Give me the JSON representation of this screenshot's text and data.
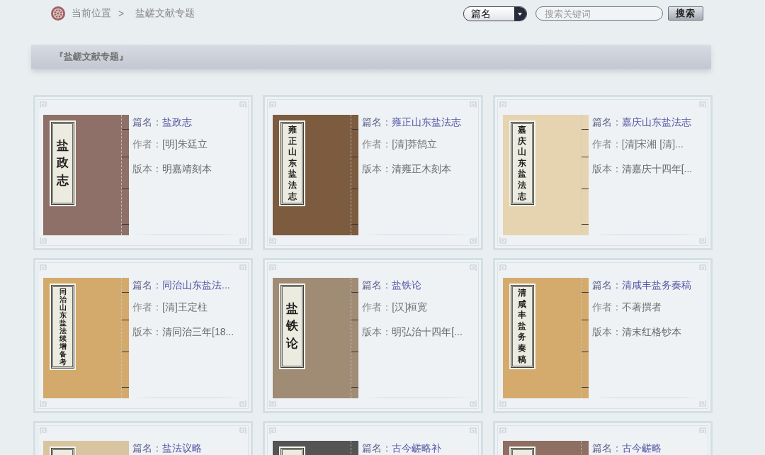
{
  "breadcrumb": {
    "label": "当前位置",
    "separator": ">",
    "current": "盐鹾文献专题"
  },
  "search": {
    "field": "篇名",
    "placeholder": "搜索关键词",
    "button": "搜索"
  },
  "section": {
    "title": "『盐鹾文献专题』"
  },
  "books": [
    {
      "title_label": "篇名：",
      "title": "盐政志",
      "author_label": "作者：",
      "author": "[明]朱廷立",
      "edition_label": "版本：",
      "edition": "明嘉靖刻本",
      "cover_text": "盐政志",
      "color": "#8f7068"
    },
    {
      "title_label": "篇名：",
      "title": "雍正山东盐法志",
      "author_label": "作者：",
      "author": "[清]莽鹄立",
      "edition_label": "版本：",
      "edition": "清雍正木刻本",
      "cover_text": "雍正山东盐法志",
      "color": "#7d5b3f"
    },
    {
      "title_label": "篇名：",
      "title": "嘉庆山东盐法志",
      "author_label": "作者：",
      "author": "[清]宋湘 [清]...",
      "edition_label": "版本：",
      "edition": "清嘉庆十四年[...",
      "cover_text": "嘉庆山东盐法志",
      "color": "#e6d4b0"
    },
    {
      "title_label": "篇名：",
      "title": "同治山东盐法...",
      "author_label": "作者：",
      "author": "[清]王定柱",
      "edition_label": "版本：",
      "edition": "清同治三年[18...",
      "cover_text": "同治山东盐法续增备考",
      "color": "#d3aa6c"
    },
    {
      "title_label": "篇名：",
      "title": "盐铁论",
      "author_label": "作者：",
      "author": "[汉]桓宽",
      "edition_label": "版本：",
      "edition": "明弘治十四年[...",
      "cover_text": "盐铁论",
      "color": "#a08b75"
    },
    {
      "title_label": "篇名：",
      "title": "清咸丰盐务奏稿",
      "author_label": "作者：",
      "author": "不著撰者",
      "edition_label": "版本：",
      "edition": "清末红格钞本",
      "cover_text": "清咸丰盐务奏稿",
      "color": "#d4ab6d"
    },
    {
      "title_label": "篇名：",
      "title": "盐法议略",
      "color": "#d9c4a0"
    },
    {
      "title_label": "篇名：",
      "title": "古今鹾略补",
      "color": "#545454"
    },
    {
      "title_label": "篇名：",
      "title": "古今鹾略",
      "color": "#8e6f61"
    }
  ]
}
